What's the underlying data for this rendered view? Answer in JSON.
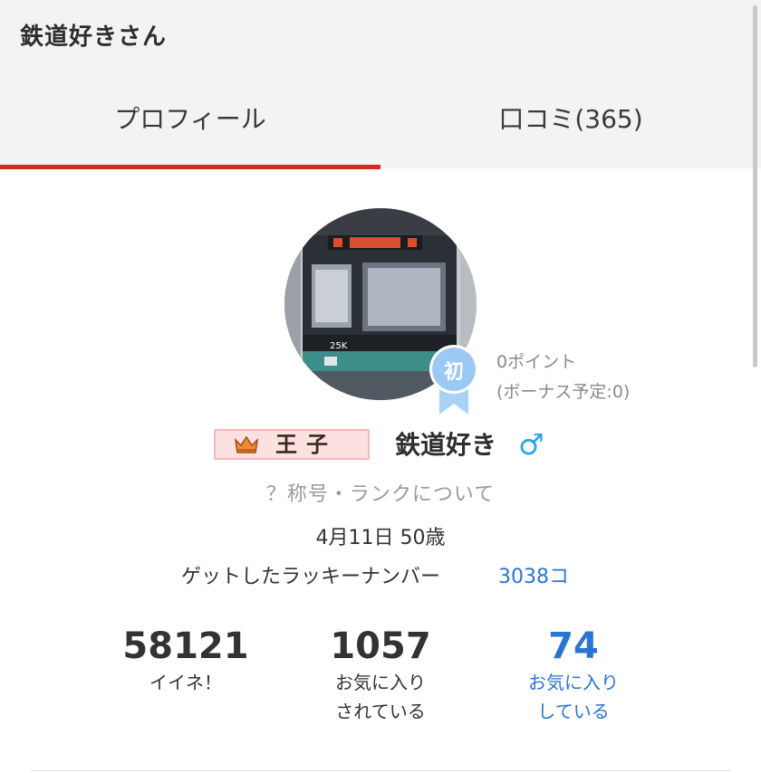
{
  "header": {
    "title": "鉄道好きさん"
  },
  "tabs": [
    {
      "label": "プロフィール",
      "active": true
    },
    {
      "label": "口コミ(365)",
      "active": false
    }
  ],
  "profile": {
    "badge_char": "初",
    "points": "0ポイント",
    "bonus": "(ボーナス予定:0)",
    "rank_title": "王子",
    "username": "鉄道好き",
    "gender_symbol": "♂",
    "rank_link": "？称号・ランクについて",
    "birthday": "4月11日 50歳",
    "lucky_label": "ゲットしたラッキーナンバー",
    "lucky_value": "3038コ"
  },
  "stats": [
    {
      "value": "58121",
      "label": "イイネ！"
    },
    {
      "value": "1057",
      "label": "お気に入り\nされている"
    },
    {
      "value": "74",
      "label": "お気に入り\nしている"
    }
  ],
  "colors": {
    "accent_red": "#d62b25",
    "link_blue": "#2a75d1",
    "gender_blue": "#29a6e8",
    "badge_blue": "#9cc9f3"
  }
}
